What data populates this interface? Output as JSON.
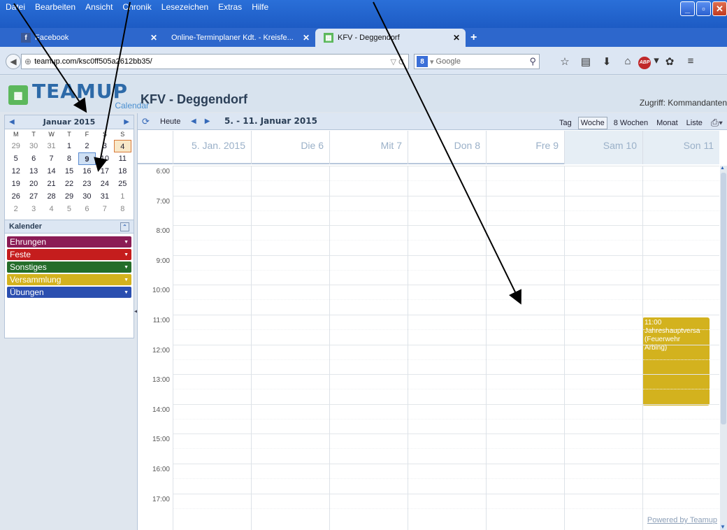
{
  "browser": {
    "menu": [
      "Datei",
      "Bearbeiten",
      "Ansicht",
      "Chronik",
      "Lesezeichen",
      "Extras",
      "Hilfe"
    ],
    "tabs": [
      {
        "label": "Facebook"
      },
      {
        "label": "Online-Terminplaner Kdt. - Kreisfe..."
      },
      {
        "label": "KFV - Deggendorf"
      }
    ],
    "url": "teamup.com/ksc0ff505a2612bb35/",
    "search_engine": "Google"
  },
  "app": {
    "logo_text": "TEAMUP",
    "logo_sub": "Calendar",
    "calendar_title": "KFV - Deggendorf",
    "access": "Zugriff: Kommandanten"
  },
  "minical": {
    "title": "Januar 2015",
    "weekdays": [
      "M",
      "T",
      "W",
      "T",
      "F",
      "S",
      "S"
    ],
    "days": [
      [
        "29",
        "30",
        "31",
        "1",
        "2",
        "3",
        "4"
      ],
      [
        "5",
        "6",
        "7",
        "8",
        "9",
        "10",
        "11"
      ],
      [
        "12",
        "13",
        "14",
        "15",
        "16",
        "17",
        "18"
      ],
      [
        "19",
        "20",
        "21",
        "22",
        "23",
        "24",
        "25"
      ],
      [
        "26",
        "27",
        "28",
        "29",
        "30",
        "31",
        "1"
      ],
      [
        "2",
        "3",
        "4",
        "5",
        "6",
        "7",
        "8"
      ]
    ]
  },
  "calendars": {
    "header": "Kalender",
    "items": [
      {
        "label": "Ehrungen",
        "color": "#8b1c55"
      },
      {
        "label": "Feste",
        "color": "#c51d1d"
      },
      {
        "label": "Sonstiges",
        "color": "#246d2a"
      },
      {
        "label": "Versammlung",
        "color": "#d3b21e"
      },
      {
        "label": "Übungen",
        "color": "#2b4fb0"
      }
    ]
  },
  "toolbar": {
    "today": "Heute",
    "range": "5. - 11. Januar 2015",
    "views": [
      "Tag",
      "Woche",
      "8 Wochen",
      "Monat",
      "Liste"
    ]
  },
  "days": [
    "5. Jan. 2015",
    "Die 6",
    "Mit 7",
    "Don 8",
    "Fre 9",
    "Sam 10",
    "Son 11"
  ],
  "hours": [
    "6:00",
    "7:00",
    "8:00",
    "9:00",
    "10:00",
    "11:00",
    "12:00",
    "13:00",
    "14:00",
    "15:00",
    "16:00",
    "17:00"
  ],
  "event": {
    "time": "11:00",
    "line1": "Jahreshauptversa",
    "line2": "(Feuerwehr",
    "line3": "Arbing)",
    "color": "#d3b21e"
  },
  "footer": {
    "powered": "Powered by Teamup"
  }
}
